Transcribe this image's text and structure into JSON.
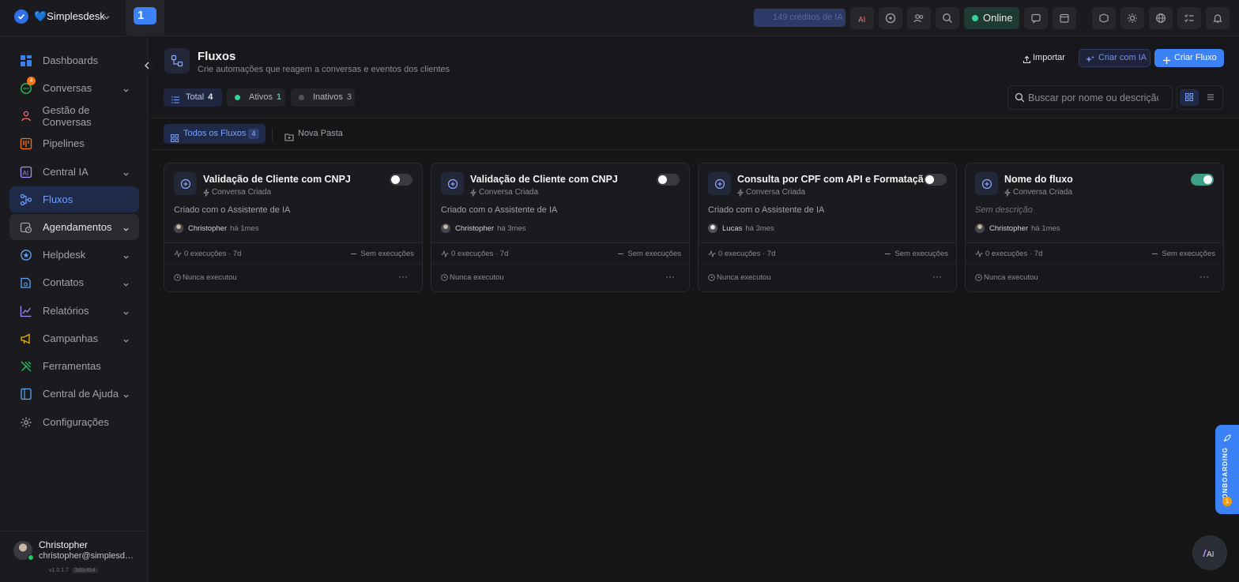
{
  "topbar": {
    "brand": "💙Simplesdesk",
    "tab_number": "1",
    "credits_label": "149 créditos de IA",
    "status_label": "Online"
  },
  "sidebar": {
    "items": [
      {
        "label": "Dashboards",
        "icon": "dashboard-icon"
      },
      {
        "label": "Conversas",
        "icon": "chat-icon",
        "badge": "4"
      },
      {
        "label": "Gestão de Conversas",
        "icon": "coffee-icon"
      },
      {
        "label": "Pipelines",
        "icon": "kanban-icon"
      },
      {
        "label": "Central IA",
        "icon": "ai-icon"
      },
      {
        "label": "Fluxos",
        "icon": "flow-icon"
      },
      {
        "label": "Agendamentos",
        "icon": "calendar-clock-icon"
      },
      {
        "label": "Helpdesk",
        "icon": "helpdesk-icon"
      },
      {
        "label": "Contatos",
        "icon": "contacts-icon"
      },
      {
        "label": "Relatórios",
        "icon": "chart-line-icon"
      },
      {
        "label": "Campanhas",
        "icon": "megaphone-icon"
      },
      {
        "label": "Ferramentas",
        "icon": "tools-icon"
      },
      {
        "label": "Central de Ajuda",
        "icon": "book-icon"
      },
      {
        "label": "Configurações",
        "icon": "gear-icon"
      }
    ],
    "user": {
      "name": "Christopher",
      "email": "christopher@simplesdesk.com",
      "version": "v1.0.1.7",
      "hash": "3d6c4b4"
    }
  },
  "header": {
    "title": "Fluxos",
    "subtitle": "Crie automações que reagem a conversas e eventos dos clientes",
    "import_label": "Importar",
    "ai_label": "Criar com IA",
    "create_label": "Criar Fluxo",
    "filters": [
      {
        "label": "Total",
        "count": "4"
      },
      {
        "label": "Ativos",
        "count": "1"
      },
      {
        "label": "Inativos",
        "count": "3"
      }
    ],
    "search_placeholder": "Buscar por nome ou descrição"
  },
  "folders": {
    "all_label": "Todos os Fluxos",
    "all_count": "4",
    "new_label": "Nova Pasta"
  },
  "cards": [
    {
      "title": "Validação de Cliente com CNPJ",
      "trigger": "Conversa Criada",
      "description": "Criado com o Assistente de IA",
      "author": "Christopher",
      "ago": "há 1mes",
      "active": false,
      "executions": "0 execuções · 7d",
      "no_exec": "Sem execuções",
      "last_run": "Nunca executou"
    },
    {
      "title": "Validação de Cliente com CNPJ",
      "trigger": "Conversa Criada",
      "description": "Criado com o Assistente de IA",
      "author": "Christopher",
      "ago": "há 3mes",
      "active": false,
      "executions": "0 execuções · 7d",
      "no_exec": "Sem execuções",
      "last_run": "Nunca executou"
    },
    {
      "title": "Consulta por CPF com API e Formatação",
      "trigger": "Conversa Criada",
      "description": "Criado com o Assistente de IA",
      "author": "Lucas",
      "ago": "há 3mes",
      "active": false,
      "executions": "0 execuções · 7d",
      "no_exec": "Sem execuções",
      "last_run": "Nunca executou"
    },
    {
      "title": "Nome do fluxo",
      "trigger": "Conversa Criada",
      "description": "Sem descrição",
      "author": "Christopher",
      "ago": "há 1mes",
      "active": true,
      "executions": "0 execuções · 7d",
      "no_exec": "Sem execuções",
      "last_run": "Nunca executou"
    }
  ],
  "onboarding": {
    "label": "ONBOARDING",
    "count": "1"
  },
  "colors": {
    "accent": "#3b82f6",
    "active_toggle": "#3f9e86",
    "online": "#34d399"
  }
}
